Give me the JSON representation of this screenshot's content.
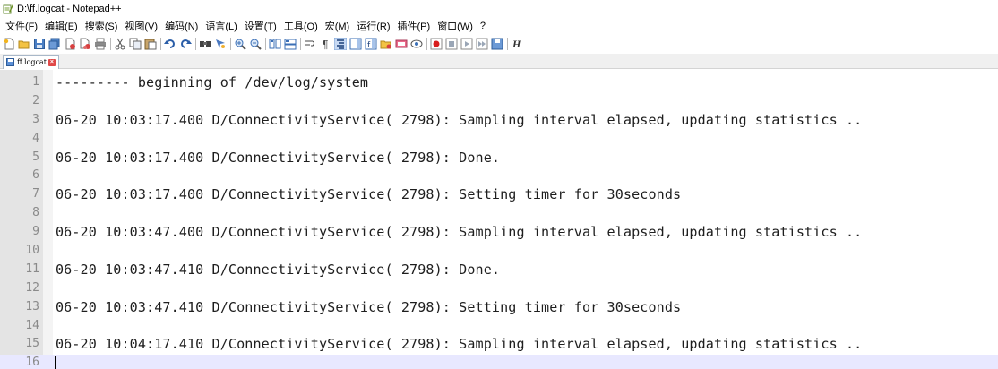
{
  "window": {
    "title": "D:\\ff.logcat - Notepad++"
  },
  "menu": [
    "文件(F)",
    "编辑(E)",
    "搜索(S)",
    "视图(V)",
    "编码(N)",
    "语言(L)",
    "设置(T)",
    "工具(O)",
    "宏(M)",
    "运行(R)",
    "插件(P)",
    "窗口(W)",
    "?"
  ],
  "toolbar": {
    "icons": [
      "new-file-icon",
      "open-file-icon",
      "save-icon",
      "save-all-icon",
      "close-icon",
      "close-all-icon",
      "print-icon",
      "cut-icon",
      "copy-icon",
      "paste-icon",
      "undo-icon",
      "redo-icon",
      "find-icon",
      "replace-icon",
      "zoom-in-icon",
      "zoom-out-icon",
      "sync-vertical-icon",
      "sync-horizontal-icon",
      "word-wrap-icon",
      "show-all-characters-icon",
      "indent-guide-icon",
      "document-map-icon",
      "function-list-icon",
      "folder-workspace-icon",
      "monitoring-icon",
      "record-macro-icon",
      "stop-record-icon",
      "play-macro-icon",
      "play-multiple-icon",
      "save-macro-icon"
    ],
    "last_glyph": "H"
  },
  "tabs": [
    {
      "label": "ff.logcat",
      "active": true
    }
  ],
  "editor": {
    "current_line": 16,
    "lines": [
      {
        "num": "1",
        "text": "--------- beginning of /dev/log/system"
      },
      {
        "num": "2",
        "text": ""
      },
      {
        "num": "3",
        "text": "06-20 10:03:17.400 D/ConnectivityService( 2798): Sampling interval elapsed, updating statistics .."
      },
      {
        "num": "4",
        "text": ""
      },
      {
        "num": "5",
        "text": "06-20 10:03:17.400 D/ConnectivityService( 2798): Done."
      },
      {
        "num": "6",
        "text": ""
      },
      {
        "num": "7",
        "text": "06-20 10:03:17.400 D/ConnectivityService( 2798): Setting timer for 30seconds"
      },
      {
        "num": "8",
        "text": ""
      },
      {
        "num": "9",
        "text": "06-20 10:03:47.400 D/ConnectivityService( 2798): Sampling interval elapsed, updating statistics .."
      },
      {
        "num": "10",
        "text": ""
      },
      {
        "num": "11",
        "text": "06-20 10:03:47.410 D/ConnectivityService( 2798): Done."
      },
      {
        "num": "12",
        "text": ""
      },
      {
        "num": "13",
        "text": "06-20 10:03:47.410 D/ConnectivityService( 2798): Setting timer for 30seconds"
      },
      {
        "num": "14",
        "text": ""
      },
      {
        "num": "15",
        "text": "06-20 10:04:17.410 D/ConnectivityService( 2798): Sampling interval elapsed, updating statistics .."
      },
      {
        "num": "16",
        "text": ""
      }
    ]
  }
}
